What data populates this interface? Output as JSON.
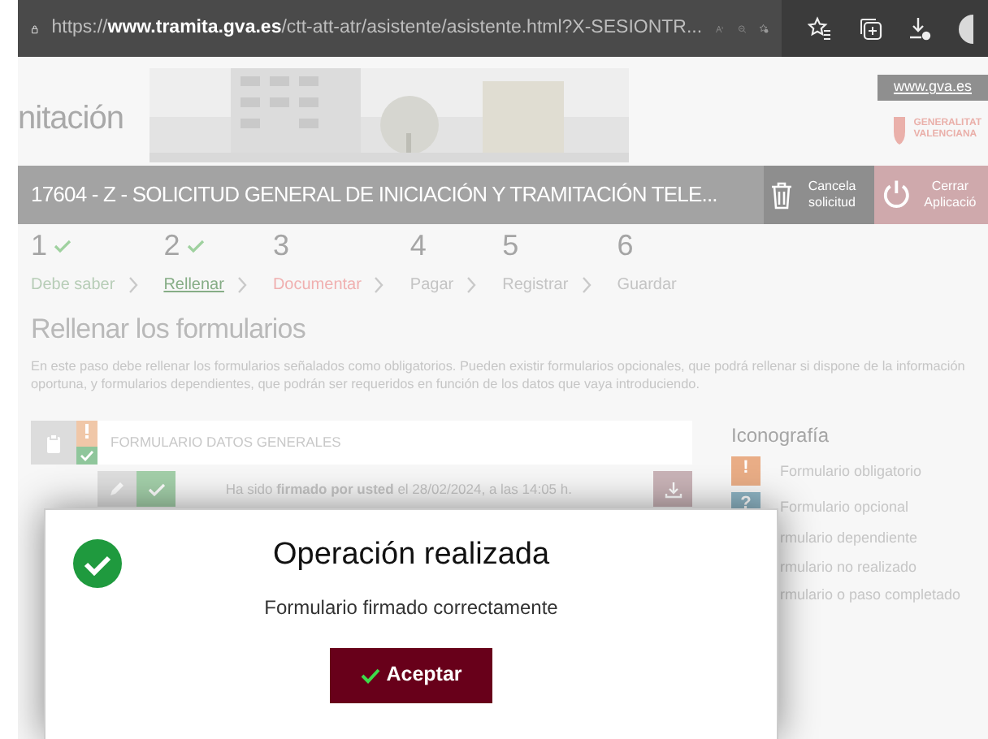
{
  "browser": {
    "url_prefix": "https://",
    "url_host": "www.tramita.gva.es",
    "url_path": "/ctt-att-atr/asistente/asistente.html?X-SESIONTR..."
  },
  "header": {
    "title": "nitación",
    "site_link": "www.gva.es",
    "logo_lines": [
      "GENERALITAT",
      "VALENCIANA"
    ]
  },
  "procedure": {
    "title": "17604 - Z - SOLICITUD GENERAL DE INICIACIÓN Y TRAMITACIÓN TELE...",
    "actions": [
      {
        "kind": "cancel",
        "label": "Cancela solicitud"
      },
      {
        "kind": "close",
        "label": "Cerrar Aplicació"
      }
    ]
  },
  "steps": [
    {
      "number": "1",
      "label": "Debe saber",
      "done": true,
      "selected": false,
      "color": "#b7cdb7"
    },
    {
      "number": "2",
      "label": "Rellenar",
      "done": true,
      "selected": true,
      "color": "#86ad86"
    },
    {
      "number": "3",
      "label": "Documentar",
      "done": false,
      "selected": false,
      "color": "#f0b0b0"
    },
    {
      "number": "4",
      "label": "Pagar",
      "done": false,
      "selected": false,
      "color": "#c4c4c4"
    },
    {
      "number": "5",
      "label": "Registrar",
      "done": false,
      "selected": false,
      "color": "#c4c4c4"
    },
    {
      "number": "6",
      "label": "Guardar",
      "done": false,
      "selected": false,
      "color": "#c4c4c4"
    }
  ],
  "section": {
    "title": "Rellenar los formularios",
    "description": "En este paso debe rellenar los formularios señalados como obligatorios. Pueden existir formularios opcionales, que podrá rellenar si dispone de la información oportuna, y formularios dependientes, que podrán ser requeridos en función de los datos que vaya introduciendo."
  },
  "forms": [
    {
      "title": "FORMULARIO DATOS GENERALES",
      "required": true,
      "completed": true,
      "signature": {
        "signed": true,
        "text": "Ha sido **firmado por usted** el 28/02/2024, a las 14:05 h."
      }
    }
  ],
  "legend": {
    "title": "Iconografía",
    "items": [
      {
        "kind": "required",
        "icon": "!",
        "label": "Formulario obligatorio"
      },
      {
        "kind": "optional",
        "icon": "?",
        "label": "Formulario opcional"
      },
      {
        "label": "rmulario dependiente"
      },
      {
        "label": "rmulario no realizado"
      },
      {
        "label": "rmulario o paso completado"
      }
    ]
  },
  "dialog": {
    "kind": "success",
    "title": "Operación realizada",
    "message": "Formulario firmado correctamente",
    "button": "Aceptar"
  }
}
